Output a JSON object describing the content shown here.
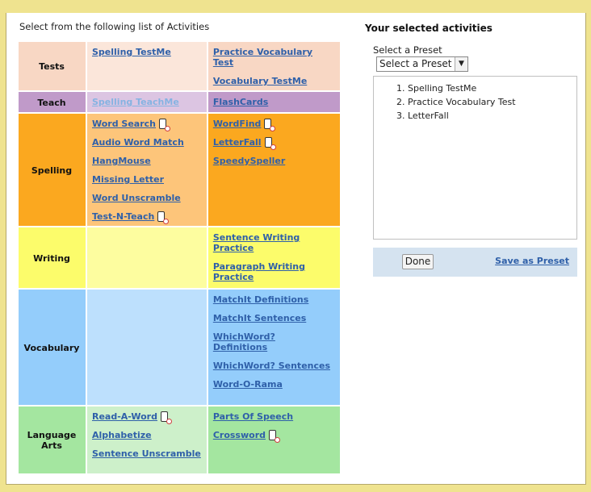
{
  "intro": "Select from the following list of Activities",
  "categories": [
    {
      "name": "Tests",
      "bg": "#f8d7c4",
      "bg1": "#fbe6da",
      "bg2": "#f8d7c4",
      "col1": [
        {
          "label": "Spelling TestMe"
        }
      ],
      "col2": [
        {
          "label": "Practice Vocabulary Test"
        },
        {
          "label": "Vocabulary TestMe"
        }
      ]
    },
    {
      "name": "Teach",
      "bg": "#c09ac9",
      "bg1": "#dcc5e2",
      "bg2": "#c09ac9",
      "col1": [
        {
          "label": "Spelling TeachMe",
          "dim": true
        }
      ],
      "col2": [
        {
          "label": "FlashCards"
        }
      ]
    },
    {
      "name": "Spelling",
      "bg": "#fba81f",
      "bg1": "#fdc57a",
      "bg2": "#fba81f",
      "col1": [
        {
          "label": "Word Search",
          "mobile": true
        },
        {
          "label": "Audio Word Match"
        },
        {
          "label": "HangMouse"
        },
        {
          "label": "Missing Letter"
        },
        {
          "label": "Word Unscramble"
        },
        {
          "label": "Test-N-Teach",
          "mobile": true
        }
      ],
      "col2": [
        {
          "label": "WordFind",
          "mobile": true
        },
        {
          "label": "LetterFall",
          "mobile": true
        },
        {
          "label": "SpeedySpeller"
        }
      ]
    },
    {
      "name": "Writing",
      "bg": "#fcfc6b",
      "bg1": "#fdfd9f",
      "bg2": "#fcfc6b",
      "col1": [],
      "col2": [
        {
          "label": "Sentence Writing Practice"
        },
        {
          "label": "Paragraph Writing Practice"
        }
      ]
    },
    {
      "name": "Vocabulary",
      "bg": "#94cdfb",
      "bg1": "#bde0fd",
      "bg2": "#94cdfb",
      "col1": [],
      "col2": [
        {
          "label": "MatchIt Definitions"
        },
        {
          "label": "MatchIt Sentences"
        },
        {
          "label": "WhichWord? Definitions"
        },
        {
          "label": "WhichWord? Sentences"
        },
        {
          "label": "Word-O-Rama"
        }
      ]
    },
    {
      "name": "Language Arts",
      "bg": "#a4e6a0",
      "bg1": "#cdf0ca",
      "bg2": "#a4e6a0",
      "col1": [
        {
          "label": "Read-A-Word",
          "mobile": true
        },
        {
          "label": "Alphabetize"
        },
        {
          "label": "Sentence Unscramble"
        }
      ],
      "col2": [
        {
          "label": "Parts Of Speech"
        },
        {
          "label": "Crossword",
          "mobile": true
        }
      ]
    }
  ],
  "panel": {
    "title": "Your selected activities",
    "preset_label": "Select a Preset",
    "preset_select": "Select a Preset",
    "selected": [
      "Spelling TestMe",
      "Practice Vocabulary Test",
      "LetterFall"
    ],
    "done": "Done",
    "save": "Save as Preset"
  }
}
